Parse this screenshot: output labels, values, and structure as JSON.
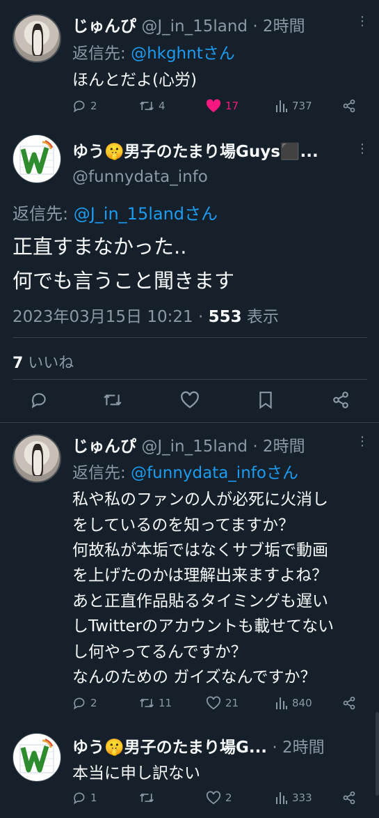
{
  "tweet1": {
    "name": "じゅんぴ",
    "handle": "@J_in_15land",
    "time": "· 2時間",
    "reply_prefix": "返信先: ",
    "reply_to": "@hkghntさん",
    "text": "ほんとだよ(心労)",
    "replies": "2",
    "retweets": "4",
    "likes": "17",
    "views": "737"
  },
  "main": {
    "name": "ゆう🤫男子のたまり場Guys⬛...",
    "handle": "@funnydata_info",
    "reply_prefix": "返信先: ",
    "reply_to": "@J_in_15landさん",
    "text_line1": "正直すまなかった..",
    "text_line2": "何でも言うこと聞きます",
    "date": "2023年03月15日 10:21 · ",
    "views_count": "553",
    "views_label": " 表示",
    "likes_count": "7",
    "likes_label": " いいね"
  },
  "tweet2": {
    "name": "じゅんぴ",
    "handle": "@J_in_15land",
    "time": "· 2時間",
    "reply_prefix": "返信先: ",
    "reply_to": "@funnydata_infoさん",
    "lines": [
      "私や私のファンの人が必死に火消し",
      "をしているのを知ってますか？",
      "何故私が本垢ではなくサブ垢で動画",
      "を上げたのかは理解出来ますよね？",
      "あと正直作品貼るタイミングも遅い",
      "しTwitterのアカウントも載せてない",
      "し何やってるんですか？",
      "なんのための ガイズなんですか？"
    ],
    "replies": "2",
    "retweets": "11",
    "likes": "21",
    "views": "840"
  },
  "tweet3": {
    "name": "ゆう🤫男子のたまり場G...",
    "time": "· 2時間",
    "text": "本当に申し訳ない",
    "replies": "1",
    "retweets": "",
    "likes": "2",
    "views": "333"
  },
  "colors": {
    "background": "#15202b",
    "text": "#f7f9f9",
    "muted": "#8b98a5",
    "link": "#1d9bf0",
    "liked": "#f91880",
    "divider": "#38444d"
  }
}
